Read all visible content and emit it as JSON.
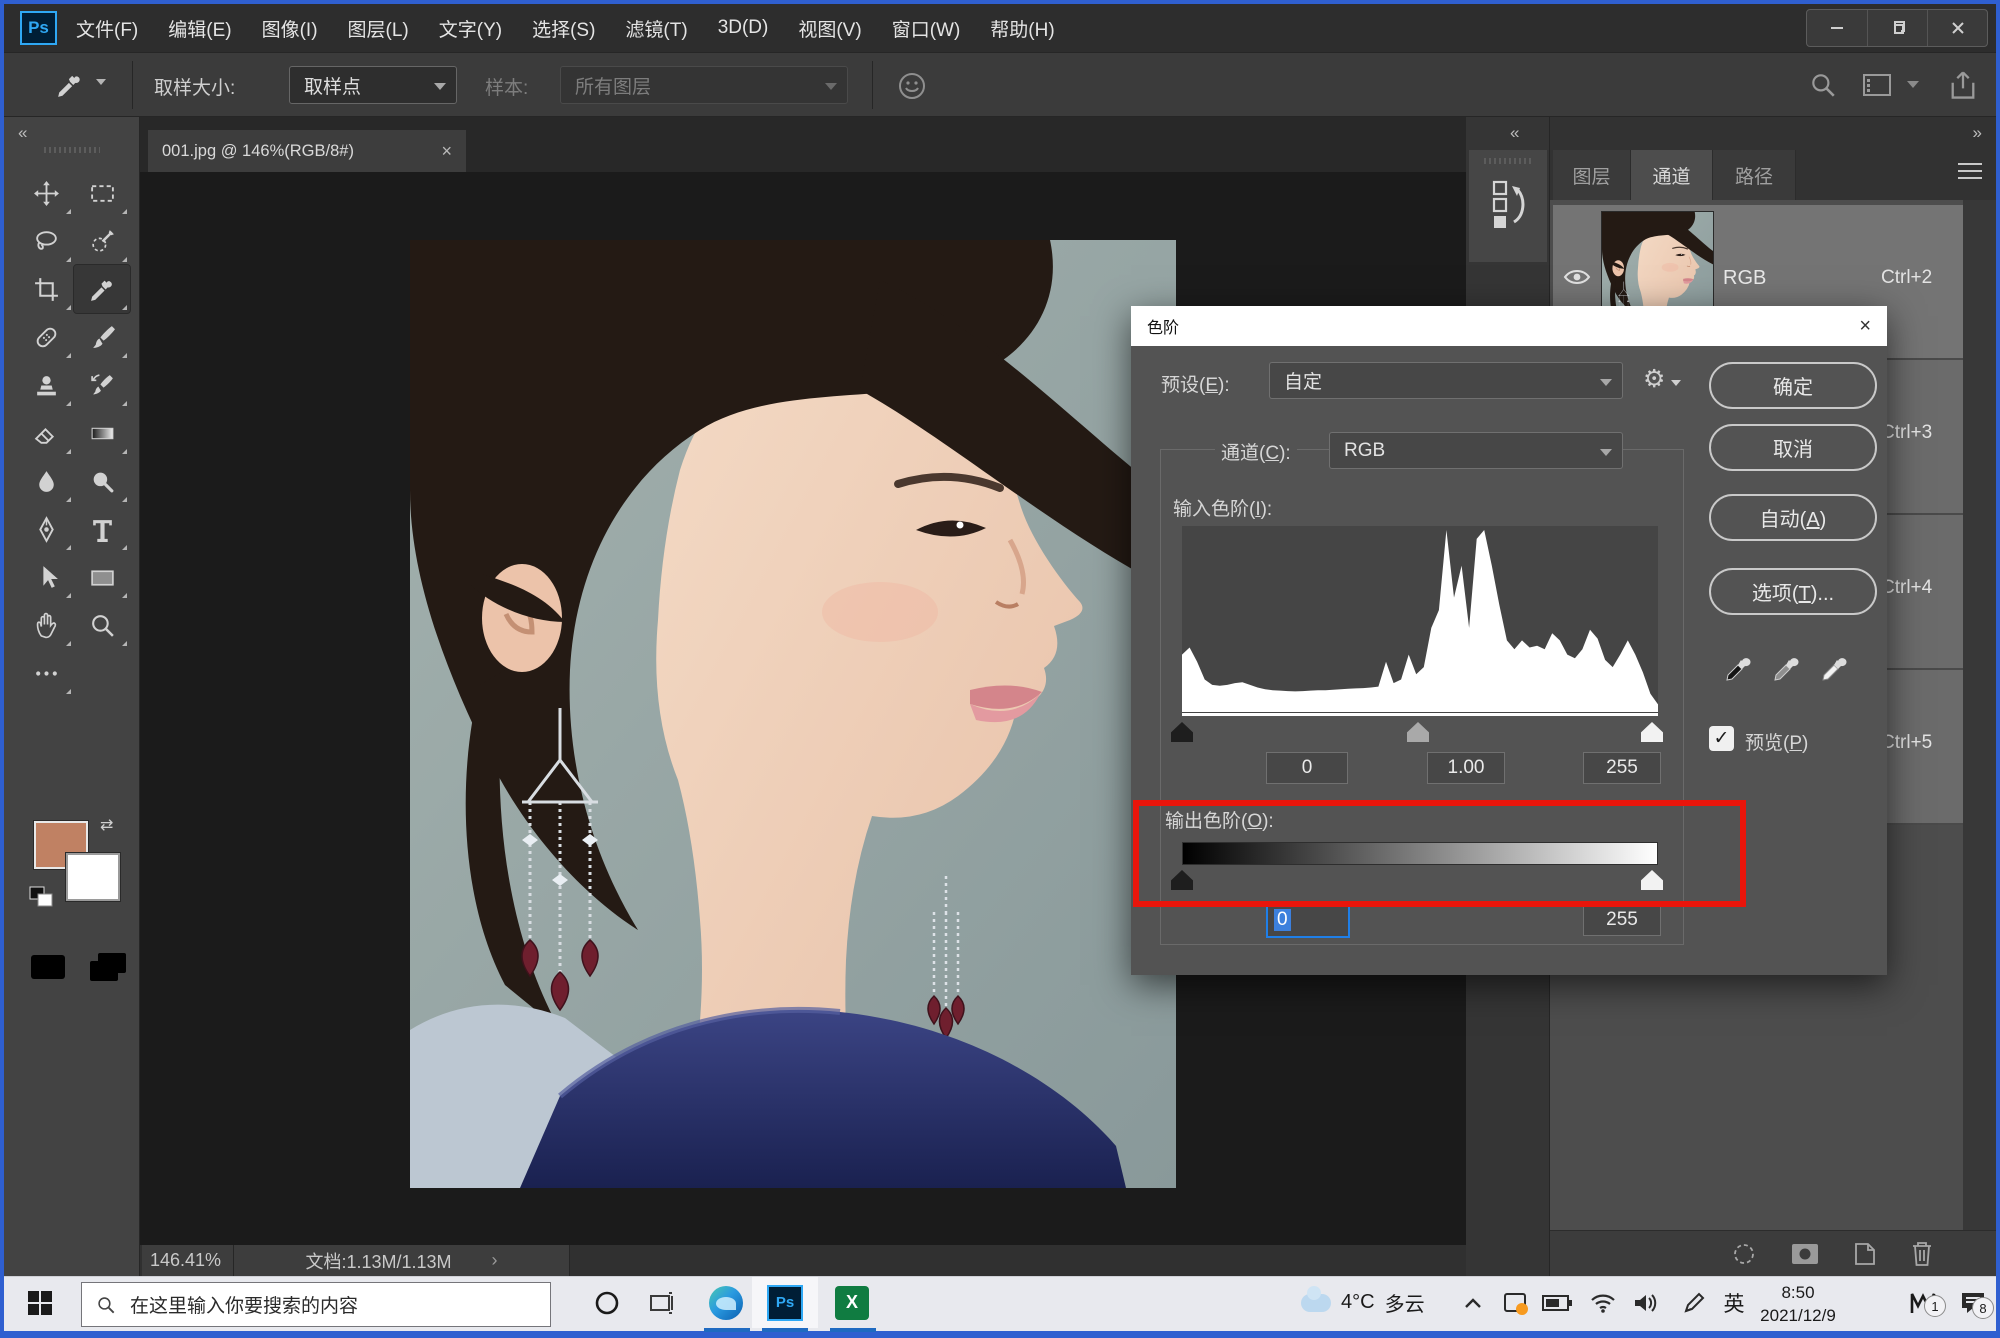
{
  "icons": {
    "gear": "⚙",
    "check": "✓",
    "collapse_left": "«",
    "collapse_right": "»",
    "chevron_right": "›",
    "close": "×",
    "swap": "⇄"
  },
  "menu_bar": {
    "logo": "Ps",
    "items": [
      "文件(F)",
      "编辑(E)",
      "图像(I)",
      "图层(L)",
      "文字(Y)",
      "选择(S)",
      "滤镜(T)",
      "3D(D)",
      "视图(V)",
      "窗口(W)",
      "帮助(H)"
    ]
  },
  "options_bar": {
    "sample_size_label": "取样大小:",
    "sample_size_value": "取样点",
    "sample_label": "样本:",
    "sample_value": "所有图层"
  },
  "toolbar": {
    "tools": [
      "move",
      "marquee",
      "lasso",
      "quick-select",
      "crop",
      "eyedropper",
      "healing",
      "brush",
      "stamp",
      "history-brush",
      "eraser",
      "gradient",
      "blur",
      "dodge",
      "pen",
      "type",
      "path-select",
      "shape",
      "hand",
      "zoom",
      "ellipsis"
    ],
    "selected_tool": "eyedropper",
    "foreground_color": "#c08163",
    "background_color": "#ffffff"
  },
  "document": {
    "tab_title": "001.jpg @ 146%(RGB/8#)",
    "zoom_level": "146.41%",
    "doc_size": "文档:1.13M/1.13M"
  },
  "dialog": {
    "title": "色阶",
    "preset_label": {
      "pre": "预设(",
      "accel": "E",
      "post": "):"
    },
    "preset_value": "自定",
    "channel_label": {
      "pre": "通道(",
      "accel": "C",
      "post": "):"
    },
    "channel_value": "RGB",
    "input_label": {
      "pre": "输入色阶(",
      "accel": "I",
      "post": "):"
    },
    "input_values": [
      "0",
      "1.00",
      "255"
    ],
    "output_label": {
      "pre": "输出色阶(",
      "accel": "O",
      "post": "):"
    },
    "output_values": [
      "0",
      "255"
    ],
    "buttons": {
      "ok": "确定",
      "cancel": "取消",
      "auto": {
        "pre": "自动(",
        "accel": "A",
        "post": ")"
      },
      "options": {
        "pre": "选项(",
        "accel": "T",
        "post": ")..."
      }
    },
    "preview_label": {
      "pre": "预览(",
      "accel": "P",
      "post": ")"
    },
    "preview_checked": true,
    "histogram": {
      "values": [
        0.3,
        0.34,
        0.26,
        0.16,
        0.13,
        0.125,
        0.13,
        0.14,
        0.145,
        0.13,
        0.115,
        0.105,
        0.1,
        0.098,
        0.095,
        0.093,
        0.095,
        0.098,
        0.1,
        0.1,
        0.102,
        0.105,
        0.108,
        0.11,
        0.112,
        0.115,
        0.12,
        0.26,
        0.14,
        0.16,
        0.3,
        0.19,
        0.23,
        0.45,
        0.55,
        1.0,
        0.62,
        0.8,
        0.45,
        0.95,
        1.0,
        0.8,
        0.58,
        0.38,
        0.33,
        0.38,
        0.34,
        0.35,
        0.33,
        0.42,
        0.38,
        0.3,
        0.28,
        0.33,
        0.44,
        0.39,
        0.27,
        0.23,
        0.3,
        0.38,
        0.3,
        0.2,
        0.08,
        0.02
      ]
    }
  },
  "channels_panel": {
    "tabs": [
      "图层",
      "通道",
      "路径"
    ],
    "active_tab": "通道",
    "rows": [
      {
        "name": "RGB",
        "shortcut": "Ctrl+2"
      },
      {
        "shortcut": "Ctrl+3"
      },
      {
        "shortcut": "Ctrl+4"
      },
      {
        "shortcut": "Ctrl+5"
      }
    ]
  },
  "taskbar": {
    "search_placeholder": "在这里输入你要搜索的内容",
    "ps_label": "Ps",
    "excel_label": "X",
    "weather_temp": "4°C",
    "weather_desc": "多云",
    "ime": "英",
    "time": "8:50",
    "date": "2021/12/9",
    "mail_badge": "1",
    "notification_badge": "8"
  },
  "annotation": {
    "color": "#e9150b"
  }
}
